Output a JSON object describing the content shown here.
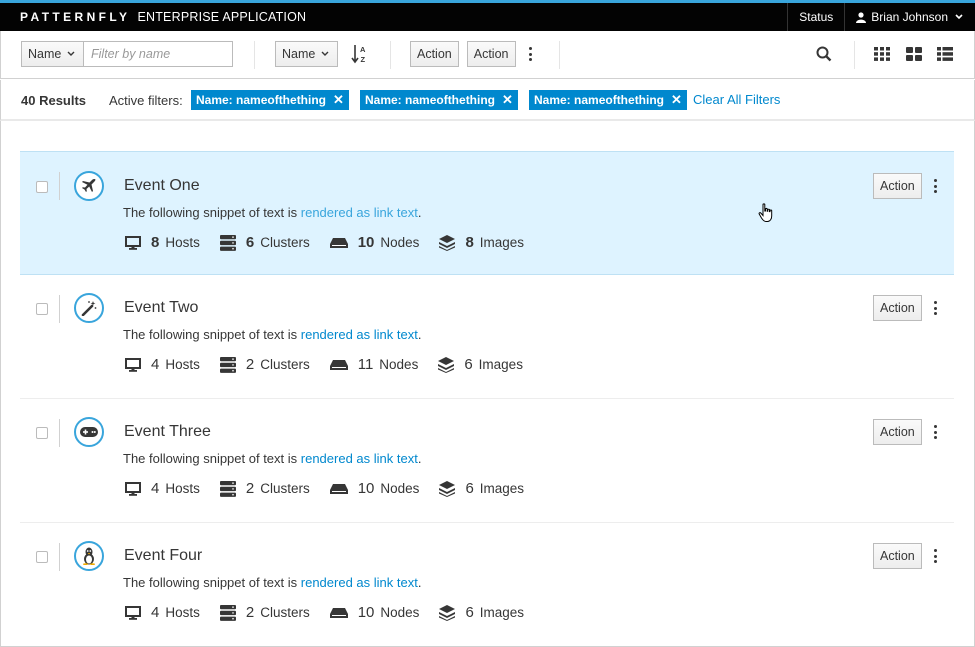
{
  "masthead": {
    "brand_bold": "PATTERNFLY",
    "brand_app": "ENTERPRISE APPLICATION",
    "status_label": "Status",
    "user_name": "Brian Johnson"
  },
  "toolbar": {
    "filter_field": "Name",
    "filter_placeholder": "Filter by name",
    "sort_field": "Name",
    "action_1": "Action",
    "action_2": "Action",
    "view_modes": [
      "small-grid-icon",
      "large-grid-icon",
      "list-view-icon"
    ]
  },
  "results": {
    "count": "40 Results",
    "active_filters_label": "Active filters:",
    "filters": [
      "Name: nameofthething",
      "Name: nameofthething",
      "Name: nameofthething"
    ],
    "clear_all": "Clear All Filters"
  },
  "list": {
    "items": [
      {
        "title": "Event One",
        "icon": "plane-icon",
        "snippet_prefix": "The following snippet of text is ",
        "snippet_link": "rendered as link text",
        "snippet_suffix": ".",
        "hosts": "8",
        "hosts_label": "Hosts",
        "clusters": "6",
        "clusters_label": "Clusters",
        "nodes": "10",
        "nodes_label": "Nodes",
        "images": "8",
        "images_label": "Images",
        "action": "Action",
        "active": true
      },
      {
        "title": "Event Two",
        "icon": "magic-wand-icon",
        "snippet_prefix": "The following snippet of text is ",
        "snippet_link": "rendered as link text",
        "snippet_suffix": ".",
        "hosts": "4",
        "hosts_label": "Hosts",
        "clusters": "2",
        "clusters_label": "Clusters",
        "nodes": "11",
        "nodes_label": "Nodes",
        "images": "6",
        "images_label": "Images",
        "action": "Action",
        "active": false
      },
      {
        "title": "Event Three",
        "icon": "gamepad-icon",
        "snippet_prefix": "The following snippet of text is ",
        "snippet_link": "rendered as link text",
        "snippet_suffix": ".",
        "hosts": "4",
        "hosts_label": "Hosts",
        "clusters": "2",
        "clusters_label": "Clusters",
        "nodes": "10",
        "nodes_label": "Nodes",
        "images": "6",
        "images_label": "Images",
        "action": "Action",
        "active": false
      },
      {
        "title": "Event Four",
        "icon": "linux-icon",
        "snippet_prefix": "The following snippet of text is ",
        "snippet_link": "rendered as link text",
        "snippet_suffix": ".",
        "hosts": "4",
        "hosts_label": "Hosts",
        "clusters": "2",
        "clusters_label": "Clusters",
        "nodes": "10",
        "nodes_label": "Nodes",
        "images": "6",
        "images_label": "Images",
        "action": "Action",
        "active": false
      }
    ]
  },
  "colors": {
    "accent": "#0088ce",
    "accent_light": "#39a5dc",
    "active_row": "#def3ff",
    "masthead": "#030303"
  }
}
